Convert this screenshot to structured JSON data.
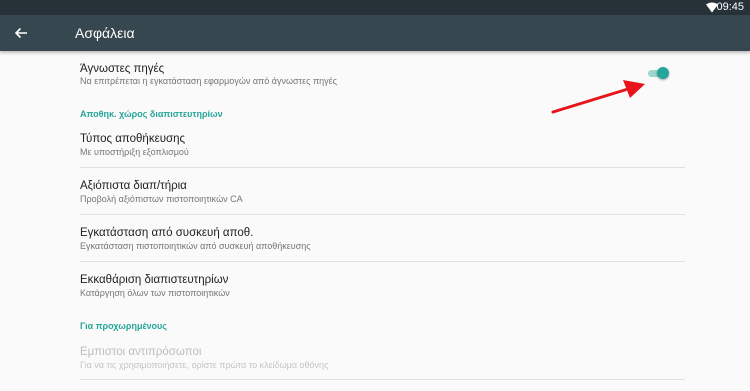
{
  "status_bar": {
    "time": "09:45",
    "wifi_icon": "wifi-icon"
  },
  "app_bar": {
    "back_icon": "arrow-back-icon",
    "title": "Ασφάλεια"
  },
  "settings": {
    "unknown_sources": {
      "title": "Άγνωστες πηγές",
      "summary": "Να επιτρέπεται η εγκατάσταση εφαρμογών από άγνωστες πηγές",
      "enabled": true
    },
    "section_storage": "Αποθηκ. χώρος διαπιστευτηρίων",
    "storage_type": {
      "title": "Τύπος αποθήκευσης",
      "summary": "Με υποστήριξη εξοπλισμού"
    },
    "trusted_credentials": {
      "title": "Αξιόπιστα διαπ/τήρια",
      "summary": "Προβολή αξιόπιστων πιστοποιητικών CA"
    },
    "install_from_storage": {
      "title": "Εγκατάσταση από συσκευή αποθ.",
      "summary": "Εγκατάσταση πιστοποιητικών από συσκευή αποθήκευσης"
    },
    "clear_credentials": {
      "title": "Εκκαθάριση διαπιστευτηρίων",
      "summary": "Κατάργηση όλων των πιστοποιητικών"
    },
    "section_advanced": "Για προχωρημένους",
    "trust_agents": {
      "title": "Εμπιστοι αντιπρόσωποι",
      "summary": "Για να τις χρησιμοποιήσετε, ορίστε πρώτα το κλείδωμα οθόνης"
    }
  },
  "colors": {
    "accent": "#26a69a",
    "toolbar": "#37474f",
    "statusbar": "#263238",
    "annotation_arrow": "#e8141b"
  }
}
